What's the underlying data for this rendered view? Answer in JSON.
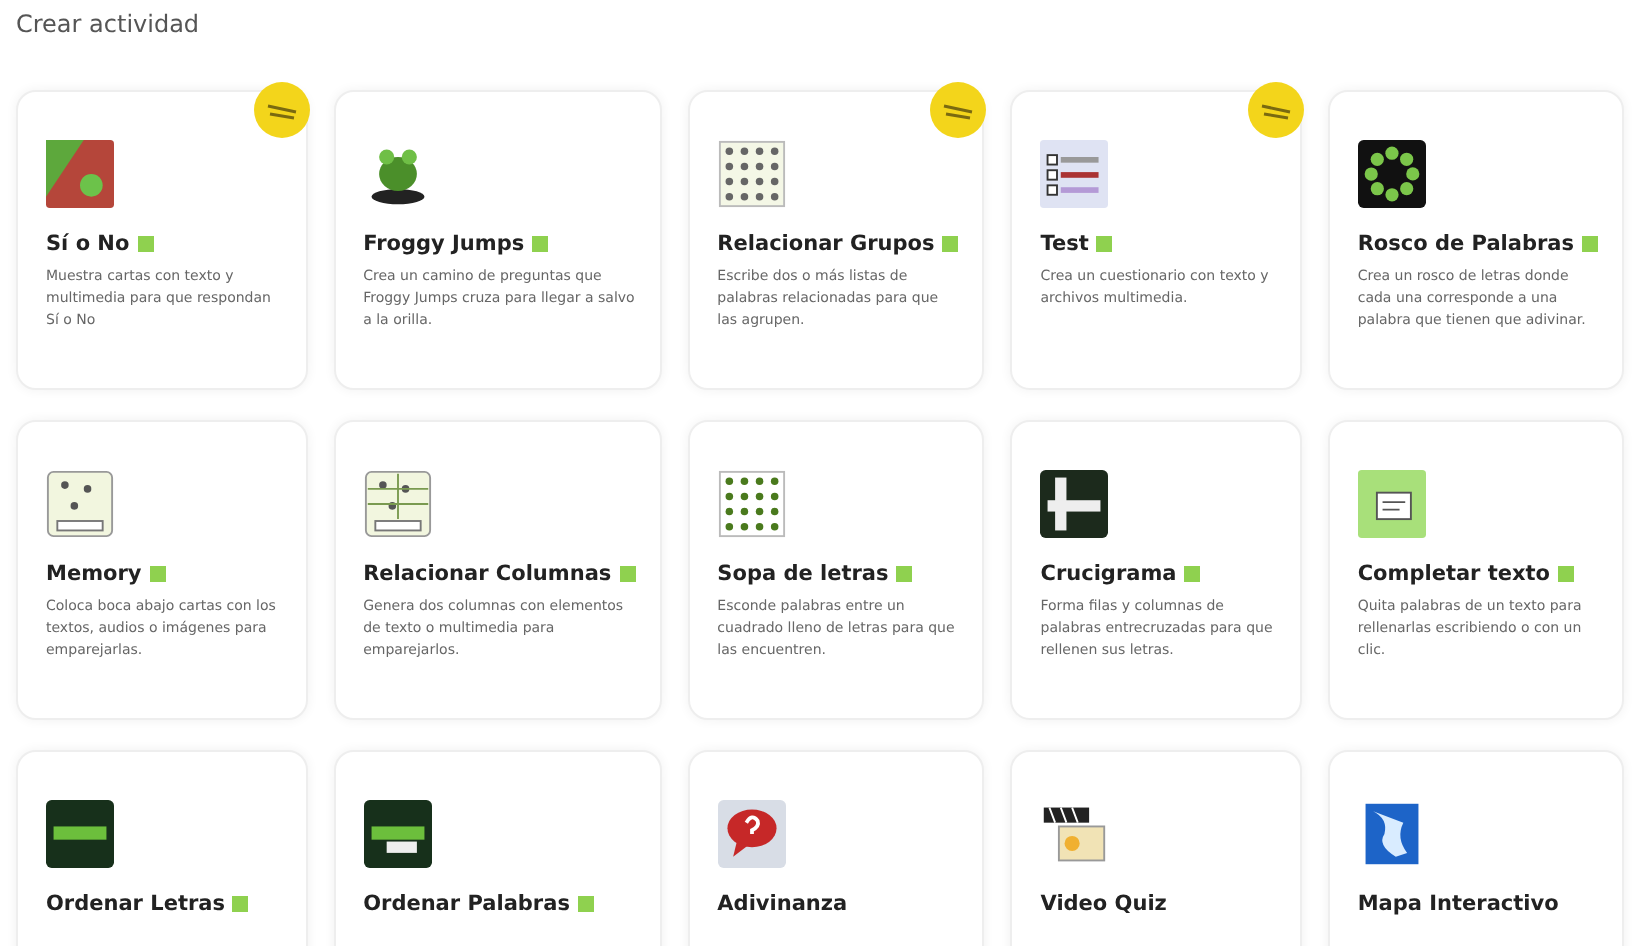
{
  "heading": "Crear actividad",
  "activities": [
    {
      "kind": "yes-no",
      "title": "Sí o No",
      "marked": true,
      "featured": true,
      "description": "Muestra cartas con texto y multimedia para que respondan Sí o No"
    },
    {
      "kind": "frog",
      "title": "Froggy Jumps",
      "marked": true,
      "featured": false,
      "description": "Crea un camino de preguntas que Froggy Jumps cruza para llegar a salvo a la orilla."
    },
    {
      "kind": "grid",
      "title": "Relacionar Grupos",
      "marked": true,
      "featured": true,
      "description": "Escribe dos o más listas de palabras relacionadas para que las agrupen."
    },
    {
      "kind": "checklist",
      "title": "Test",
      "marked": true,
      "featured": true,
      "description": "Crea un cuestionario con texto y archivos multimedia."
    },
    {
      "kind": "ring",
      "title": "Rosco de Palabras",
      "marked": true,
      "featured": false,
      "description": "Crea un rosco de letras donde cada una corresponde a una palabra que tienen que adivinar."
    },
    {
      "kind": "memory",
      "title": "Memory",
      "marked": true,
      "featured": false,
      "description": "Coloca boca abajo cartas con los textos, audios o imágenes para emparejarlas."
    },
    {
      "kind": "columns",
      "title": "Relacionar Columnas",
      "marked": true,
      "featured": false,
      "description": "Genera dos columnas con elementos de texto o multimedia para emparejarlos."
    },
    {
      "kind": "word-search",
      "title": "Sopa de letras",
      "marked": true,
      "featured": false,
      "description": "Esconde palabras entre un cuadrado lleno de letras para que las encuentren."
    },
    {
      "kind": "crossword",
      "title": "Crucigrama",
      "marked": true,
      "featured": false,
      "description": "Forma filas y columnas de palabras entrecruzadas para que rellenen sus letras."
    },
    {
      "kind": "fill-text",
      "title": "Completar texto",
      "marked": true,
      "featured": false,
      "description": "Quita palabras de un texto para rellenarlas escribiendo o con un clic."
    },
    {
      "kind": "letters",
      "title": "Ordenar Letras",
      "marked": true,
      "featured": false
    },
    {
      "kind": "words",
      "title": "Ordenar Palabras",
      "marked": true,
      "featured": false
    },
    {
      "kind": "riddle",
      "title": "Adivinanza",
      "marked": false,
      "featured": false
    },
    {
      "kind": "video",
      "title": "Video Quiz",
      "marked": false,
      "featured": false
    },
    {
      "kind": "map",
      "title": "Mapa Interactivo",
      "marked": false,
      "featured": false
    }
  ]
}
